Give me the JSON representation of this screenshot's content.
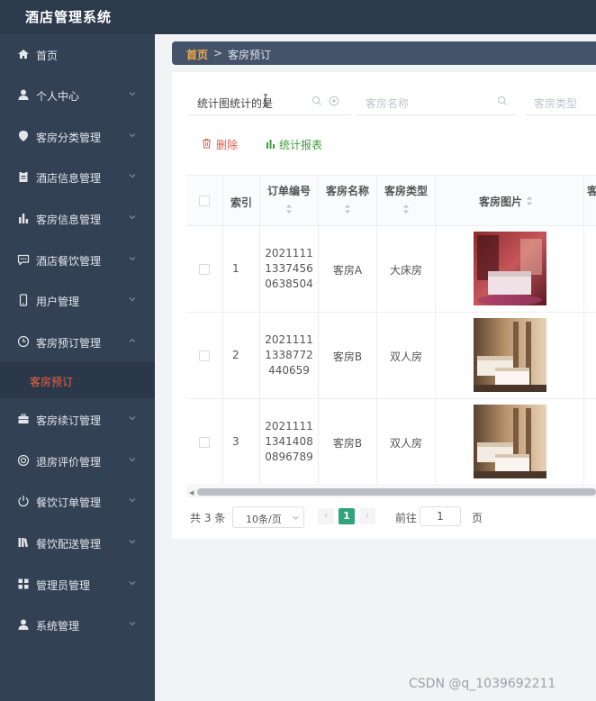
{
  "app": {
    "title": "酒店管理系统"
  },
  "sidebar": {
    "items": [
      {
        "label": "首页",
        "icon": "home-icon"
      },
      {
        "label": "个人中心",
        "icon": "user-icon"
      },
      {
        "label": "客房分类管理",
        "icon": "map-pin-icon"
      },
      {
        "label": "酒店信息管理",
        "icon": "clipboard-icon"
      },
      {
        "label": "客房信息管理",
        "icon": "bar-chart-icon"
      },
      {
        "label": "酒店餐饮管理",
        "icon": "chat-icon"
      },
      {
        "label": "用户管理",
        "icon": "phone-icon"
      },
      {
        "label": "客房预订管理",
        "icon": "clock-icon"
      },
      {
        "label": "客房续订管理",
        "icon": "briefcase-icon"
      },
      {
        "label": "退房评价管理",
        "icon": "target-icon"
      },
      {
        "label": "餐饮订单管理",
        "icon": "power-icon"
      },
      {
        "label": "餐饮配送管理",
        "icon": "books-icon"
      },
      {
        "label": "管理员管理",
        "icon": "grid-icon"
      },
      {
        "label": "系统管理",
        "icon": "user-icon"
      }
    ],
    "active_sub": "客房预订"
  },
  "breadcrumb": {
    "home": "首页",
    "separator": ">",
    "current": "客房预订"
  },
  "search": {
    "field1_value": "统计图统计的是",
    "field2_placeholder": "客房名称",
    "field3_placeholder": "客房类型"
  },
  "actions": {
    "delete_label": "删除",
    "report_label": "统计报表"
  },
  "table": {
    "headers": [
      "索引",
      "订单编号",
      "客房名称",
      "客房类型",
      "客房图片"
    ],
    "rows": [
      {
        "index": "1",
        "order_no": [
          "2021111",
          "1337456",
          "0638504"
        ],
        "room_name": "客房A",
        "room_type": "大床房"
      },
      {
        "index": "2",
        "order_no": [
          "2021111",
          "1338772",
          "440659"
        ],
        "room_name": "客房B",
        "room_type": "双人房"
      },
      {
        "index": "3",
        "order_no": [
          "2021111",
          "1341408",
          "0896789"
        ],
        "room_name": "客房B",
        "room_type": "双人房"
      }
    ],
    "next_header_fragment": "客"
  },
  "pagination": {
    "total": "共 3 条",
    "page_size": "10条/页",
    "current_page": "1",
    "goto_label": "前往",
    "goto_value": "1",
    "page_unit": "页"
  },
  "watermark": "CSDN @q_1039692211",
  "colors": {
    "topbar": "#2d3a4b",
    "sidebar": "#334154",
    "active": "#f0613c",
    "accent_green": "#2fa37a",
    "delete": "#e05a4c"
  }
}
